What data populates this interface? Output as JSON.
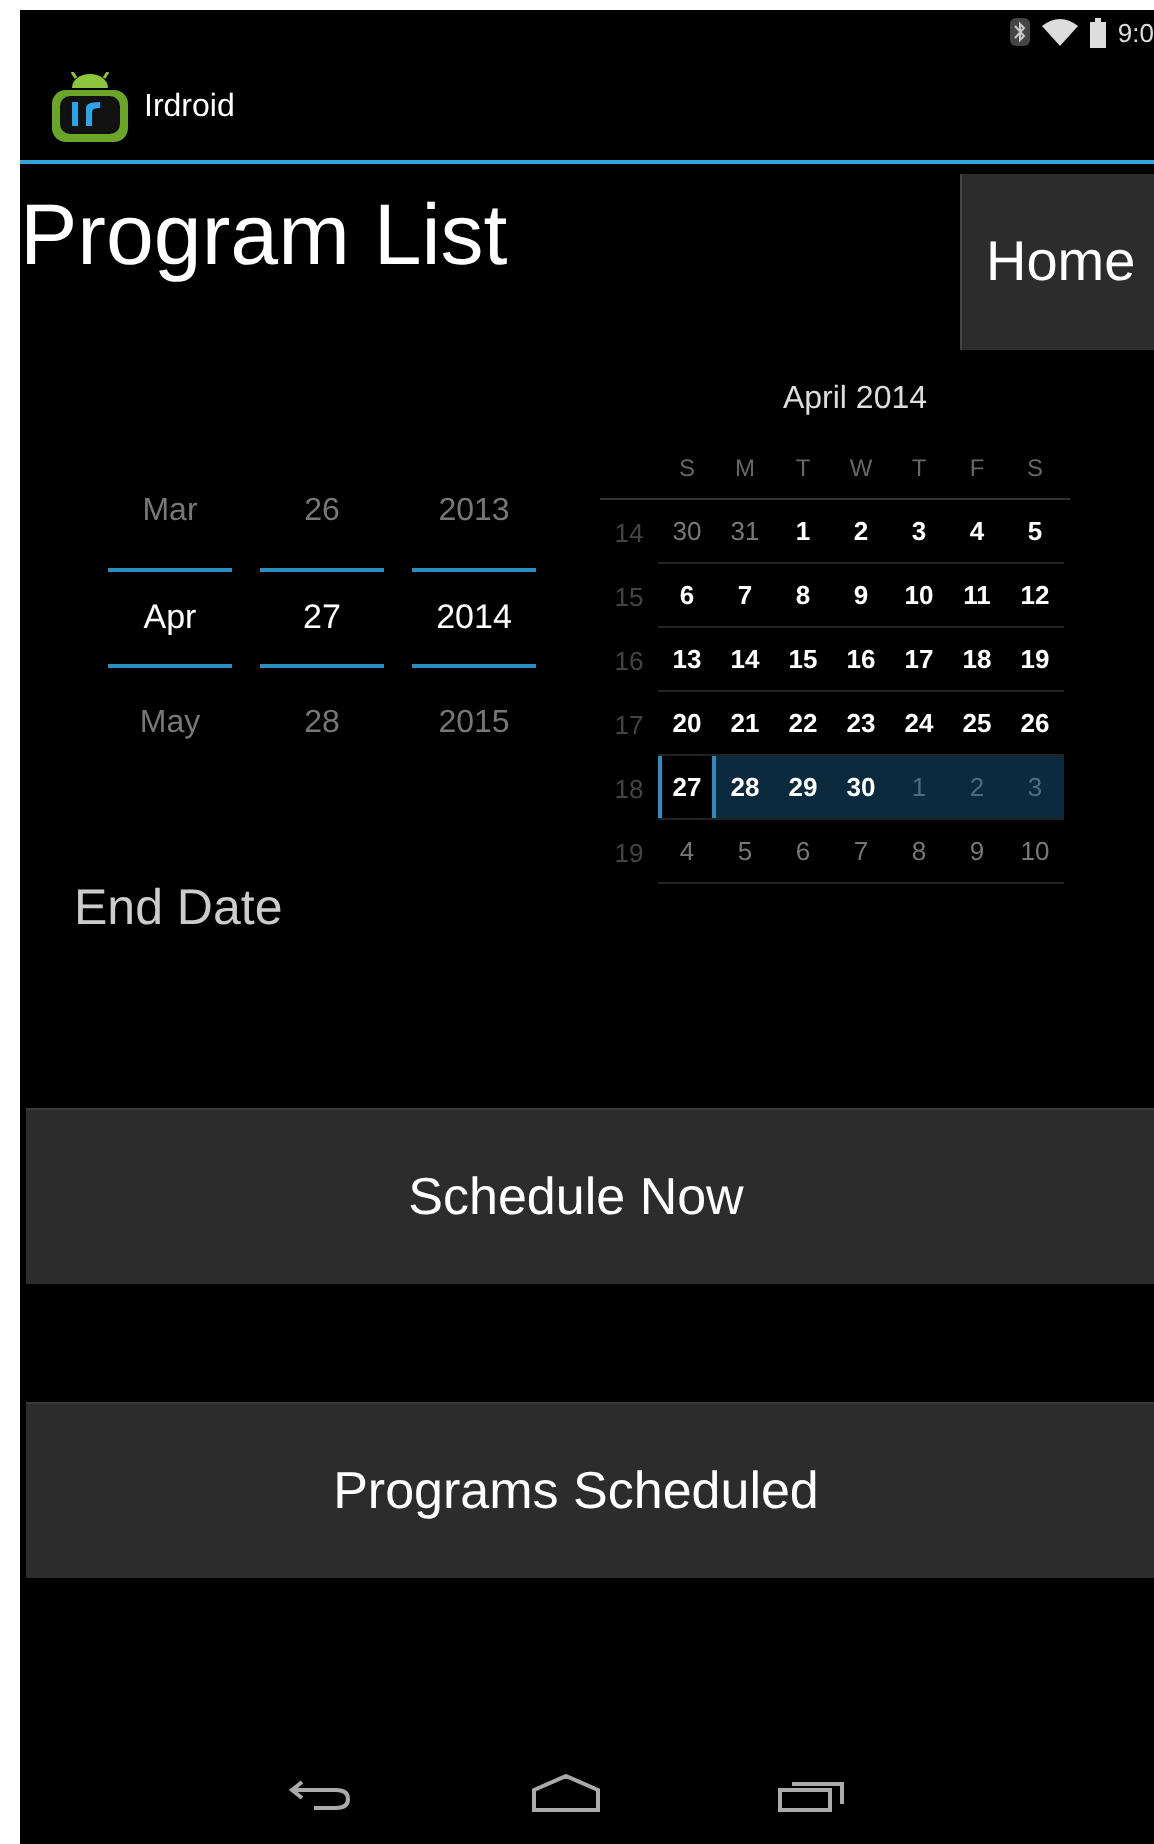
{
  "status_bar": {
    "time": "9:0"
  },
  "action_bar": {
    "title": "Irdroid"
  },
  "heading": "Program List",
  "home_button": "Home",
  "date_picker": [
    {
      "prev": "Mar",
      "current": "Apr",
      "next": "May"
    },
    {
      "prev": "26",
      "current": "27",
      "next": "28"
    },
    {
      "prev": "2013",
      "current": "2014",
      "next": "2015"
    }
  ],
  "calendar": {
    "title": "April 2014",
    "weekdays": [
      "S",
      "M",
      "T",
      "W",
      "T",
      "F",
      "S"
    ],
    "weeks": [
      {
        "number": "14",
        "selected": false,
        "days": [
          {
            "label": "30",
            "in_month": false,
            "selected": false
          },
          {
            "label": "31",
            "in_month": false,
            "selected": false
          },
          {
            "label": "1",
            "in_month": true,
            "selected": false
          },
          {
            "label": "2",
            "in_month": true,
            "selected": false
          },
          {
            "label": "3",
            "in_month": true,
            "selected": false
          },
          {
            "label": "4",
            "in_month": true,
            "selected": false
          },
          {
            "label": "5",
            "in_month": true,
            "selected": false
          }
        ]
      },
      {
        "number": "15",
        "selected": false,
        "days": [
          {
            "label": "6",
            "in_month": true,
            "selected": false
          },
          {
            "label": "7",
            "in_month": true,
            "selected": false
          },
          {
            "label": "8",
            "in_month": true,
            "selected": false
          },
          {
            "label": "9",
            "in_month": true,
            "selected": false
          },
          {
            "label": "10",
            "in_month": true,
            "selected": false
          },
          {
            "label": "11",
            "in_month": true,
            "selected": false
          },
          {
            "label": "12",
            "in_month": true,
            "selected": false
          }
        ]
      },
      {
        "number": "16",
        "selected": false,
        "days": [
          {
            "label": "13",
            "in_month": true,
            "selected": false
          },
          {
            "label": "14",
            "in_month": true,
            "selected": false
          },
          {
            "label": "15",
            "in_month": true,
            "selected": false
          },
          {
            "label": "16",
            "in_month": true,
            "selected": false
          },
          {
            "label": "17",
            "in_month": true,
            "selected": false
          },
          {
            "label": "18",
            "in_month": true,
            "selected": false
          },
          {
            "label": "19",
            "in_month": true,
            "selected": false
          }
        ]
      },
      {
        "number": "17",
        "selected": false,
        "days": [
          {
            "label": "20",
            "in_month": true,
            "selected": false
          },
          {
            "label": "21",
            "in_month": true,
            "selected": false
          },
          {
            "label": "22",
            "in_month": true,
            "selected": false
          },
          {
            "label": "23",
            "in_month": true,
            "selected": false
          },
          {
            "label": "24",
            "in_month": true,
            "selected": false
          },
          {
            "label": "25",
            "in_month": true,
            "selected": false
          },
          {
            "label": "26",
            "in_month": true,
            "selected": false
          }
        ]
      },
      {
        "number": "18",
        "selected": true,
        "days": [
          {
            "label": "27",
            "in_month": true,
            "selected": true
          },
          {
            "label": "28",
            "in_month": true,
            "selected": false
          },
          {
            "label": "29",
            "in_month": true,
            "selected": false
          },
          {
            "label": "30",
            "in_month": true,
            "selected": false
          },
          {
            "label": "1",
            "in_month": false,
            "selected": false
          },
          {
            "label": "2",
            "in_month": false,
            "selected": false
          },
          {
            "label": "3",
            "in_month": false,
            "selected": false
          }
        ]
      },
      {
        "number": "19",
        "selected": false,
        "days": [
          {
            "label": "4",
            "in_month": false,
            "selected": false
          },
          {
            "label": "5",
            "in_month": false,
            "selected": false
          },
          {
            "label": "6",
            "in_month": false,
            "selected": false
          },
          {
            "label": "7",
            "in_month": false,
            "selected": false
          },
          {
            "label": "8",
            "in_month": false,
            "selected": false
          },
          {
            "label": "9",
            "in_month": false,
            "selected": false
          },
          {
            "label": "10",
            "in_month": false,
            "selected": false
          }
        ]
      }
    ]
  },
  "end_date_label": "End Date",
  "buttons": [
    "Schedule Now",
    "Programs Scheduled"
  ]
}
